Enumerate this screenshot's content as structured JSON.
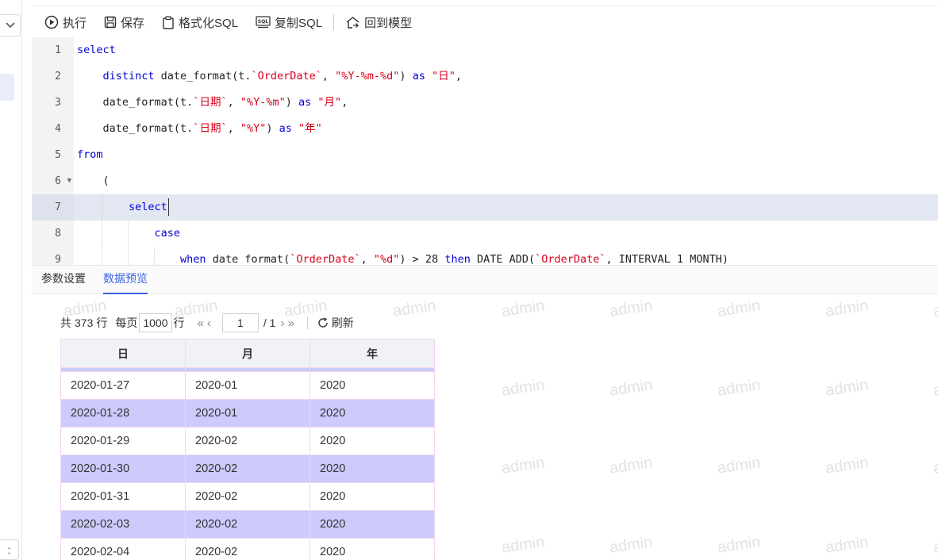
{
  "toolbar": {
    "run": "执行",
    "save": "保存",
    "format": "格式化SQL",
    "copy": "复制SQL",
    "back": "回到模型"
  },
  "editor": {
    "line_numbers": [
      "1",
      "2",
      "3",
      "4",
      "5",
      "6",
      "7",
      "8",
      "9"
    ],
    "lines": [
      [
        {
          "t": "select",
          "c": "kw"
        }
      ],
      [
        {
          "t": "    "
        },
        {
          "t": "distinct",
          "c": "kw"
        },
        {
          "t": " date_format(t."
        },
        {
          "t": "`OrderDate`",
          "c": "str"
        },
        {
          "t": ", "
        },
        {
          "t": "\"%Y-%m-%d\"",
          "c": "str"
        },
        {
          "t": ") "
        },
        {
          "t": "as",
          "c": "kw"
        },
        {
          "t": " "
        },
        {
          "t": "\"日\"",
          "c": "str"
        },
        {
          "t": ","
        }
      ],
      [
        {
          "t": "    date_format(t."
        },
        {
          "t": "`日期`",
          "c": "str"
        },
        {
          "t": ", "
        },
        {
          "t": "\"%Y-%m\"",
          "c": "str"
        },
        {
          "t": ") "
        },
        {
          "t": "as",
          "c": "kw"
        },
        {
          "t": " "
        },
        {
          "t": "\"月\"",
          "c": "str"
        },
        {
          "t": ","
        }
      ],
      [
        {
          "t": "    date_format(t."
        },
        {
          "t": "`日期`",
          "c": "str"
        },
        {
          "t": ", "
        },
        {
          "t": "\"%Y\"",
          "c": "str"
        },
        {
          "t": ") "
        },
        {
          "t": "as",
          "c": "kw"
        },
        {
          "t": " "
        },
        {
          "t": "\"年\"",
          "c": "str"
        }
      ],
      [
        {
          "t": "from",
          "c": "kw"
        }
      ],
      [
        {
          "t": "    ("
        }
      ],
      [
        {
          "t": "        "
        },
        {
          "t": "select",
          "c": "kw"
        }
      ],
      [
        {
          "t": "            "
        },
        {
          "t": "case",
          "c": "kw"
        }
      ],
      [
        {
          "t": "                "
        },
        {
          "t": "when",
          "c": "kw"
        },
        {
          "t": " date format("
        },
        {
          "t": "`OrderDate`",
          "c": "str"
        },
        {
          "t": ", "
        },
        {
          "t": "\"%d\"",
          "c": "str"
        },
        {
          "t": ") > 28 "
        },
        {
          "t": "then",
          "c": "kw"
        },
        {
          "t": " DATE ADD("
        },
        {
          "t": "`OrderDate`",
          "c": "str"
        },
        {
          "t": ", INTERVAL 1 MONTH)"
        }
      ]
    ]
  },
  "tabs": [
    {
      "label": "参数设置",
      "active": false
    },
    {
      "label": "数据预览",
      "active": true
    }
  ],
  "pager": {
    "total_prefix": "共",
    "total": "373",
    "total_suffix": "行",
    "per_page_label": "每页",
    "per_page": "1000",
    "per_page_suffix": "行",
    "current_page": "1",
    "total_pages": "/ 1",
    "refresh": "刷新"
  },
  "table": {
    "columns": [
      "日",
      "月",
      "年"
    ],
    "rows": [
      [
        "2020-01-27",
        "2020-01",
        "2020"
      ],
      [
        "2020-01-28",
        "2020-01",
        "2020"
      ],
      [
        "2020-01-29",
        "2020-02",
        "2020"
      ],
      [
        "2020-01-30",
        "2020-02",
        "2020"
      ],
      [
        "2020-01-31",
        "2020-02",
        "2020"
      ],
      [
        "2020-02-03",
        "2020-02",
        "2020"
      ],
      [
        "2020-02-04",
        "2020-02",
        "2020"
      ]
    ]
  },
  "watermark": "admin",
  "left_bottom": ":",
  "colors": {
    "accent": "#3a63e0",
    "row_alt": "#cccbfb",
    "keyword": "#0000d6",
    "string": "#d6001c"
  }
}
